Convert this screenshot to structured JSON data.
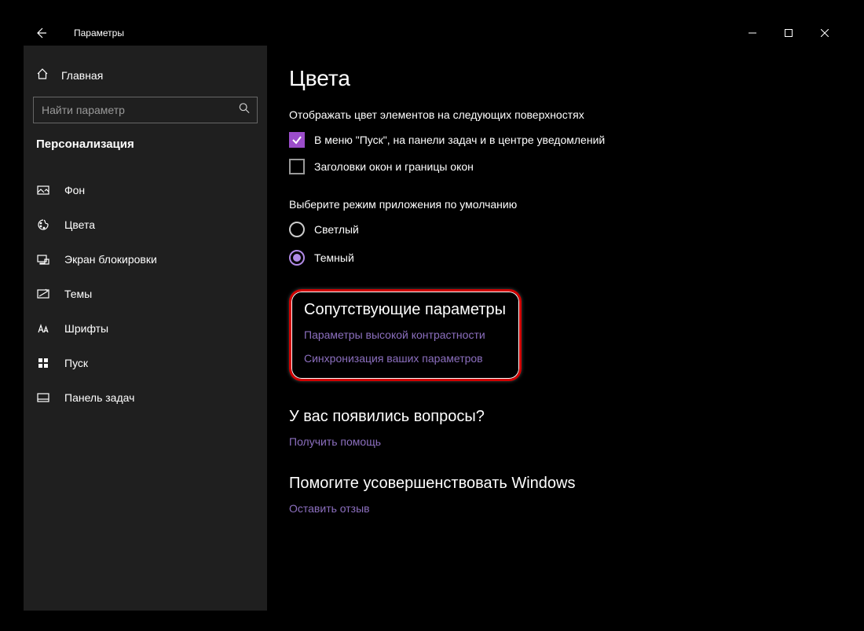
{
  "window": {
    "app_title": "Параметры"
  },
  "sidebar": {
    "home_label": "Главная",
    "search_placeholder": "Найти параметр",
    "section_label": "Персонализация",
    "items": [
      {
        "label": "Фон"
      },
      {
        "label": "Цвета"
      },
      {
        "label": "Экран блокировки"
      },
      {
        "label": "Темы"
      },
      {
        "label": "Шрифты"
      },
      {
        "label": "Пуск"
      },
      {
        "label": "Панель задач"
      }
    ]
  },
  "content": {
    "page_title": "Цвета",
    "surfaces_label": "Отображать цвет элементов на следующих поверхностях",
    "check_start": "В меню \"Пуск\", на панели задач и в центре уведомлений",
    "check_titles": "Заголовки окон и границы окон",
    "mode_label": "Выберите режим приложения по умолчанию",
    "mode_light": "Светлый",
    "mode_dark": "Темный",
    "related_heading": "Сопутствующие параметры",
    "link_contrast": "Параметры высокой контрастности",
    "link_sync": "Синхронизация ваших параметров",
    "questions_heading": "У вас появились вопросы?",
    "link_help": "Получить помощь",
    "improve_heading": "Помогите усовершенствовать Windows",
    "link_feedback": "Оставить отзыв"
  }
}
